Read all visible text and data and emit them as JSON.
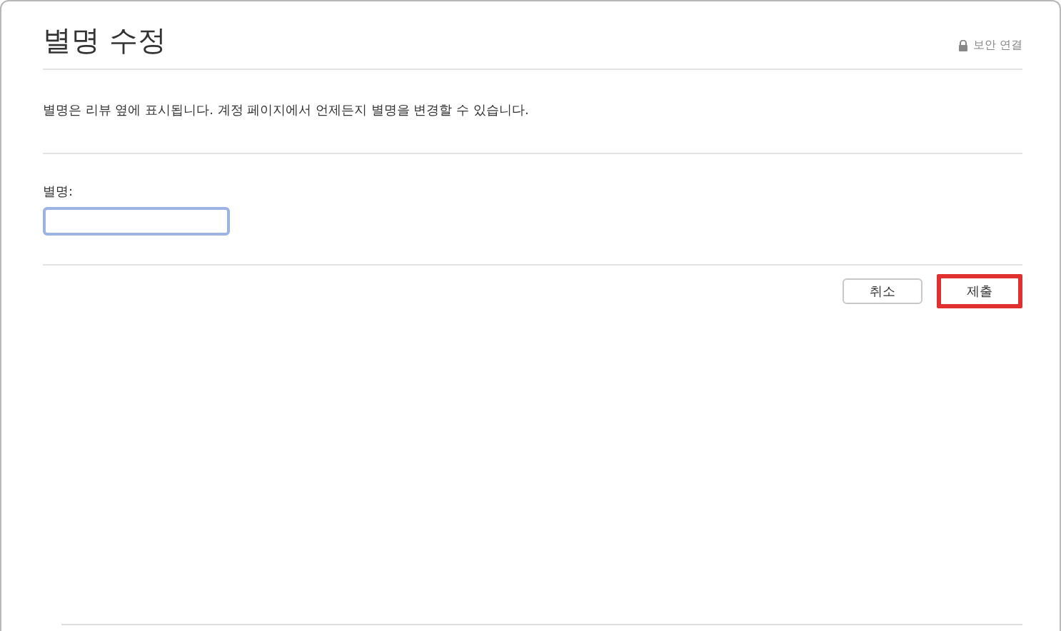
{
  "title": "별명 수정",
  "secure_label": "보안 연결",
  "description": "별명은 리뷰 옆에 표시됩니다. 계정 페이지에서 언제든지 별명을 변경할 수 있습니다.",
  "nickname_field": {
    "label": "별명:",
    "focused": true
  },
  "buttons": [
    {
      "label": "취소",
      "highlighted": false
    },
    {
      "label": "제출",
      "highlighted": true
    }
  ]
}
